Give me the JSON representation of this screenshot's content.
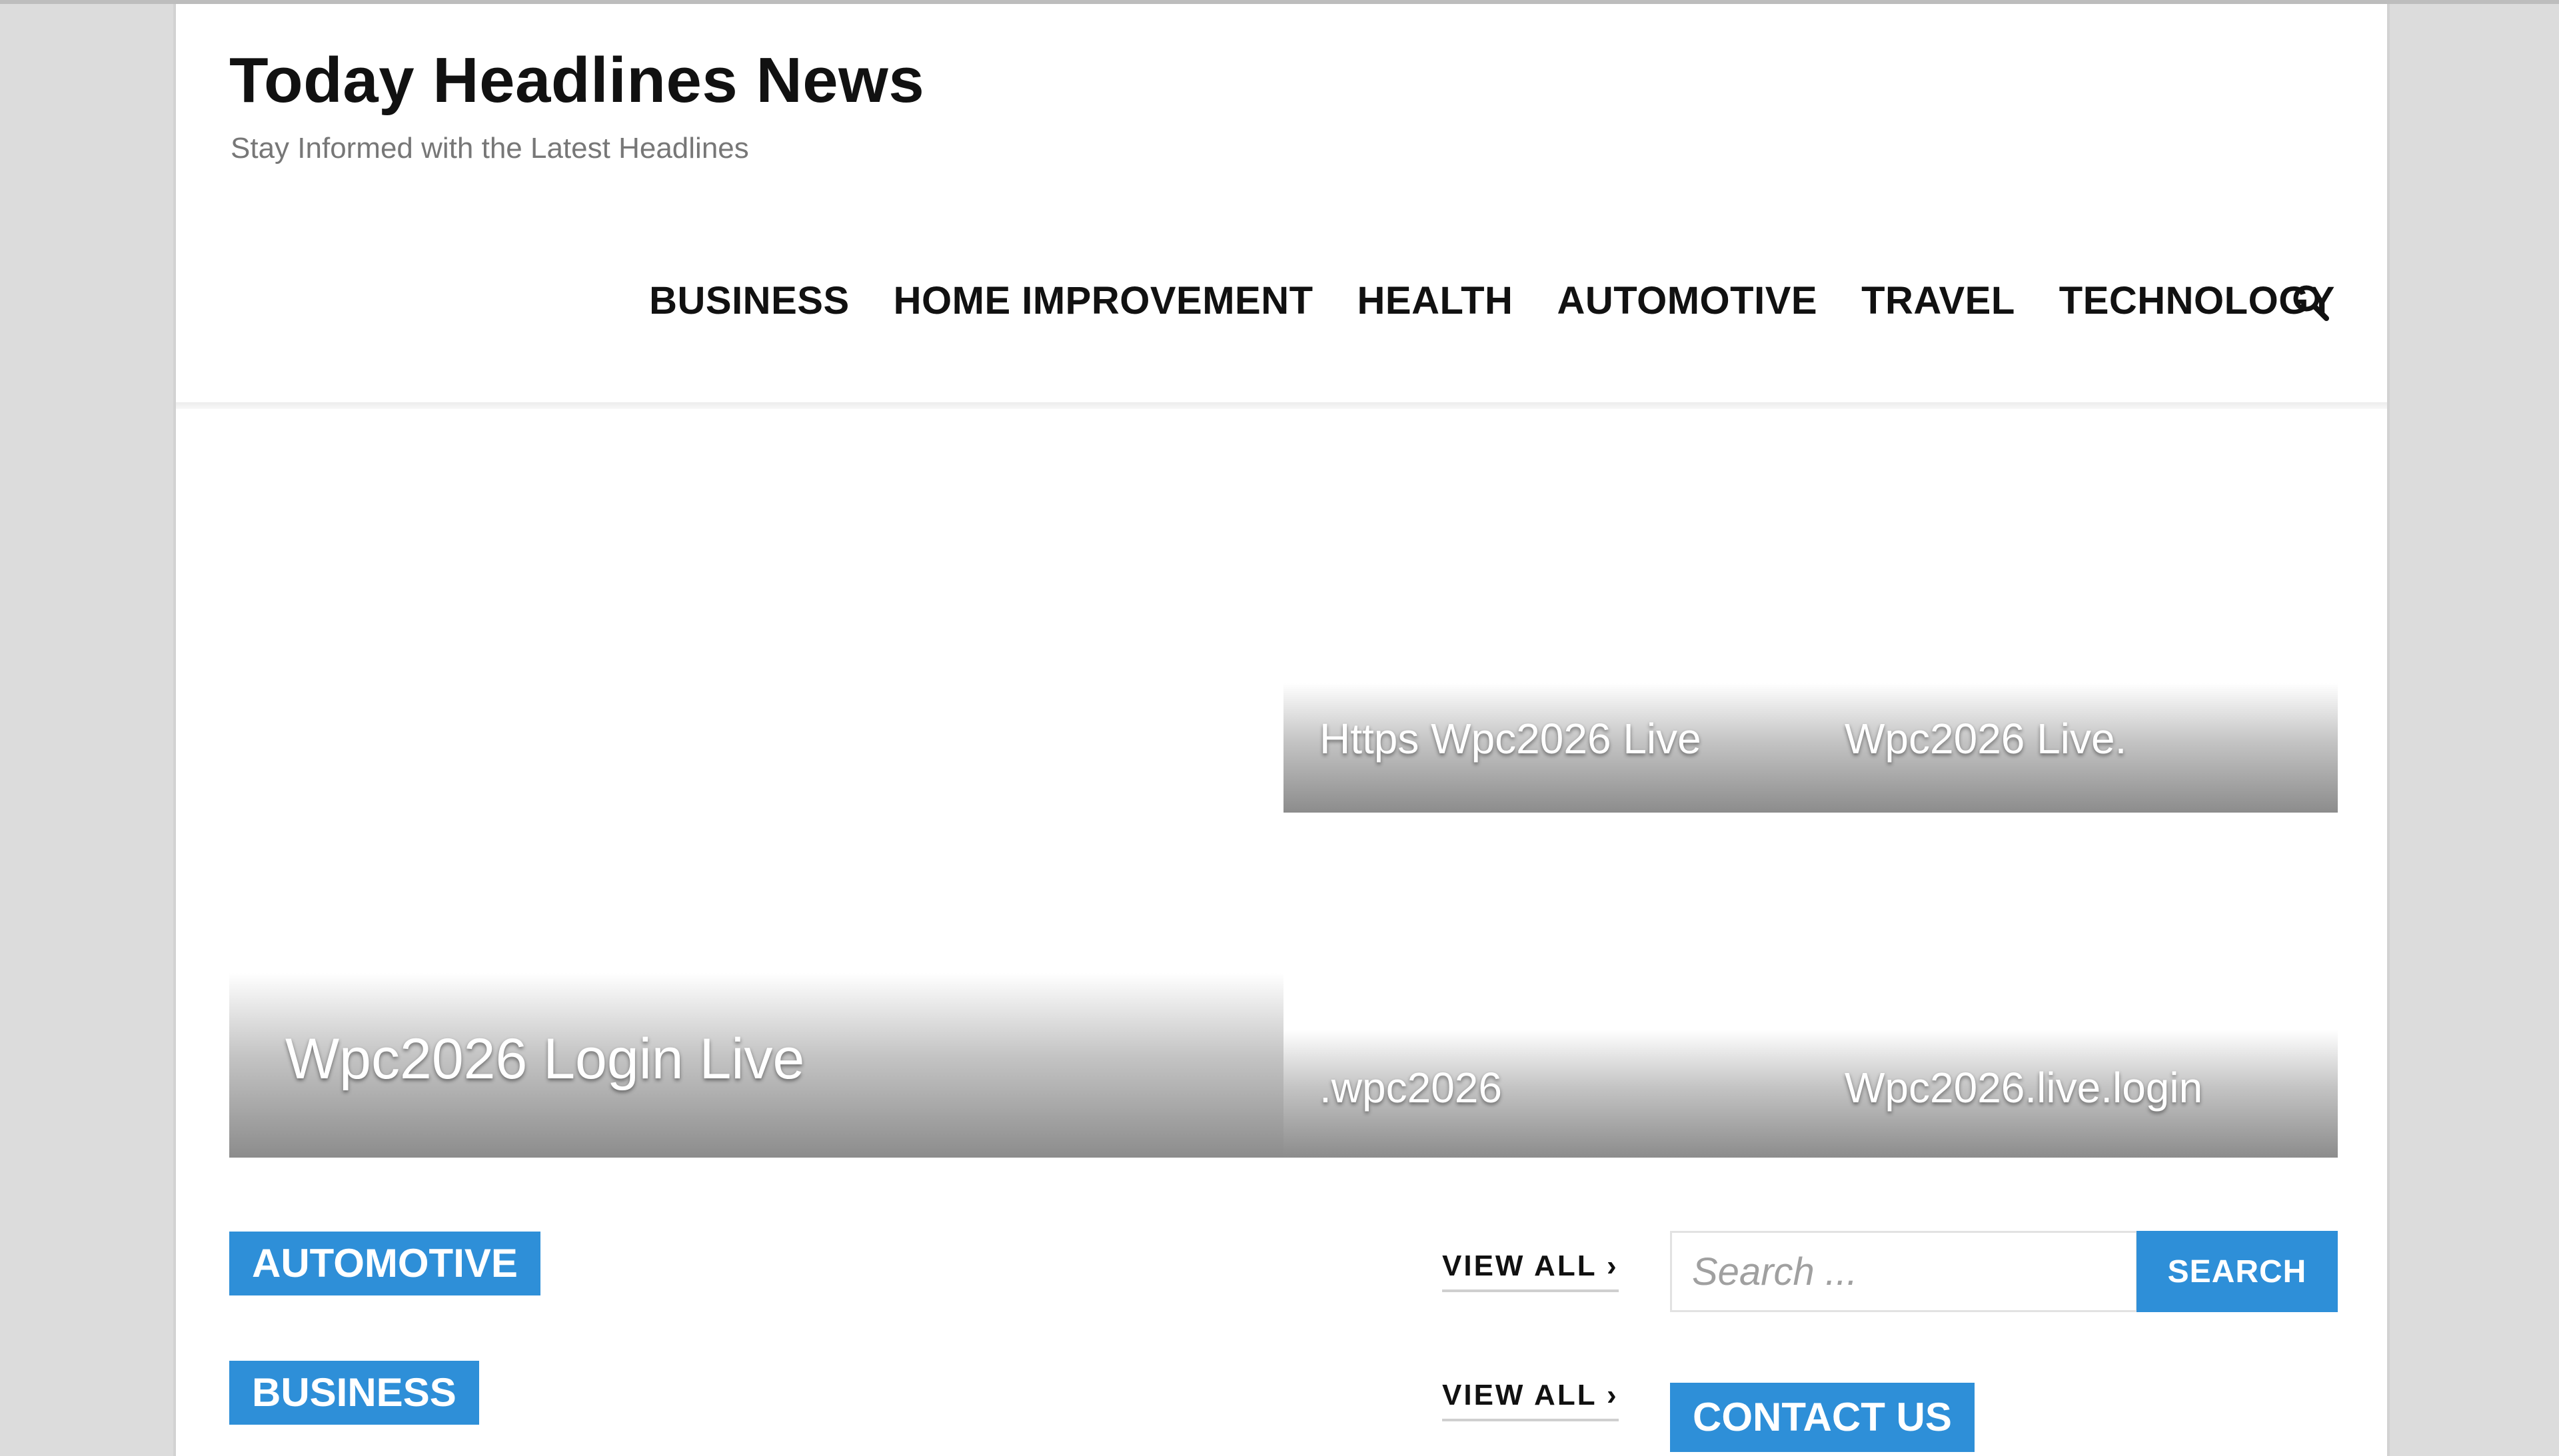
{
  "site": {
    "title": "Today Headlines News",
    "tagline": "Stay Informed with the Latest Headlines"
  },
  "nav": {
    "items": [
      {
        "label": "BUSINESS"
      },
      {
        "label": "HOME IMPROVEMENT"
      },
      {
        "label": "HEALTH"
      },
      {
        "label": "AUTOMOTIVE"
      },
      {
        "label": "TRAVEL"
      },
      {
        "label": "TECHNOLOGY"
      }
    ],
    "search_icon": "search-icon"
  },
  "featured": {
    "main": {
      "title": "Wpc2026 Login Live"
    },
    "grid": [
      {
        "title": "Https Wpc2026 Live"
      },
      {
        "title": "Wpc2026 Live."
      },
      {
        "title": ".wpc2026"
      },
      {
        "title": "Wpc2026.live.login"
      }
    ]
  },
  "categories": [
    {
      "label": "AUTOMOTIVE",
      "view_all": "VIEW ALL ›"
    },
    {
      "label": "BUSINESS",
      "view_all": "VIEW ALL ›"
    }
  ],
  "sidebar": {
    "search_placeholder": "Search ...",
    "search_button": "SEARCH",
    "contact_heading": "CONTACT US"
  },
  "colors": {
    "accent": "#2e8fd8",
    "text": "#111111",
    "tagline": "#777777"
  }
}
